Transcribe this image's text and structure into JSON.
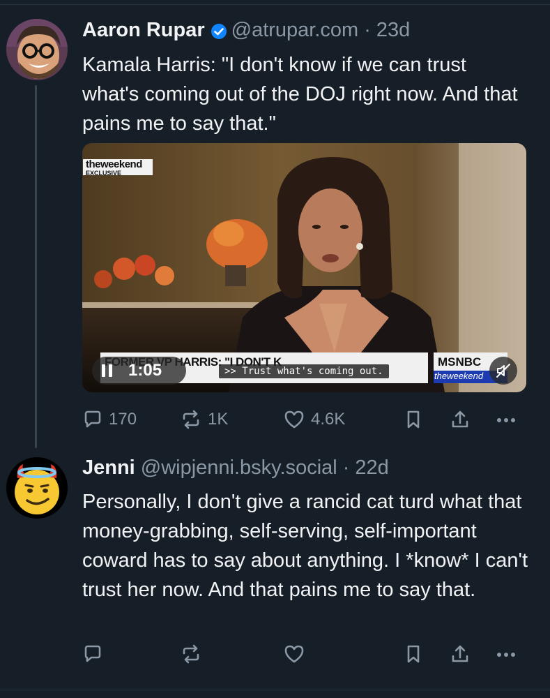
{
  "posts": [
    {
      "author": "Aaron Rupar",
      "handle": "@atrupar.com",
      "separator": "·",
      "age": "23d",
      "verified": true,
      "text": "Kamala Harris: \"I don't know if we can trust what's coming out of the DOJ right now. And that pains me to say that.\"",
      "video": {
        "show_logo_top": "theweekend",
        "show_logo_bottom": "EXCLUSIVE",
        "chyron": "FORMER VP HARRIS: \"I DON'T K",
        "network": "MSNBC",
        "network_sub": "theweekend",
        "time": "1:05",
        "caption": ">> Trust what's coming out."
      },
      "actions": {
        "replies": "170",
        "reposts": "1K",
        "likes": "4.6K"
      }
    },
    {
      "author": "Jenni",
      "handle": "@wipjenni.bsky.social",
      "separator": "·",
      "age": "22d",
      "verified": false,
      "text": "Personally, I don't give a rancid cat turd what that money-grabbing, self-serving, self-important coward has to say about anything. I *know* I can't trust her now. And that pains me to say that.",
      "actions": {
        "replies": "",
        "reposts": "",
        "likes": ""
      }
    }
  ],
  "colors": {
    "background": "#161e27",
    "text": "#f1f3f5",
    "muted": "#8b98a5",
    "verified": "#1185fe"
  },
  "icons": [
    "reply-icon",
    "repost-icon",
    "like-icon",
    "bookmark-icon",
    "share-icon",
    "more-icon",
    "verified-icon",
    "pause-icon",
    "mute-icon"
  ]
}
